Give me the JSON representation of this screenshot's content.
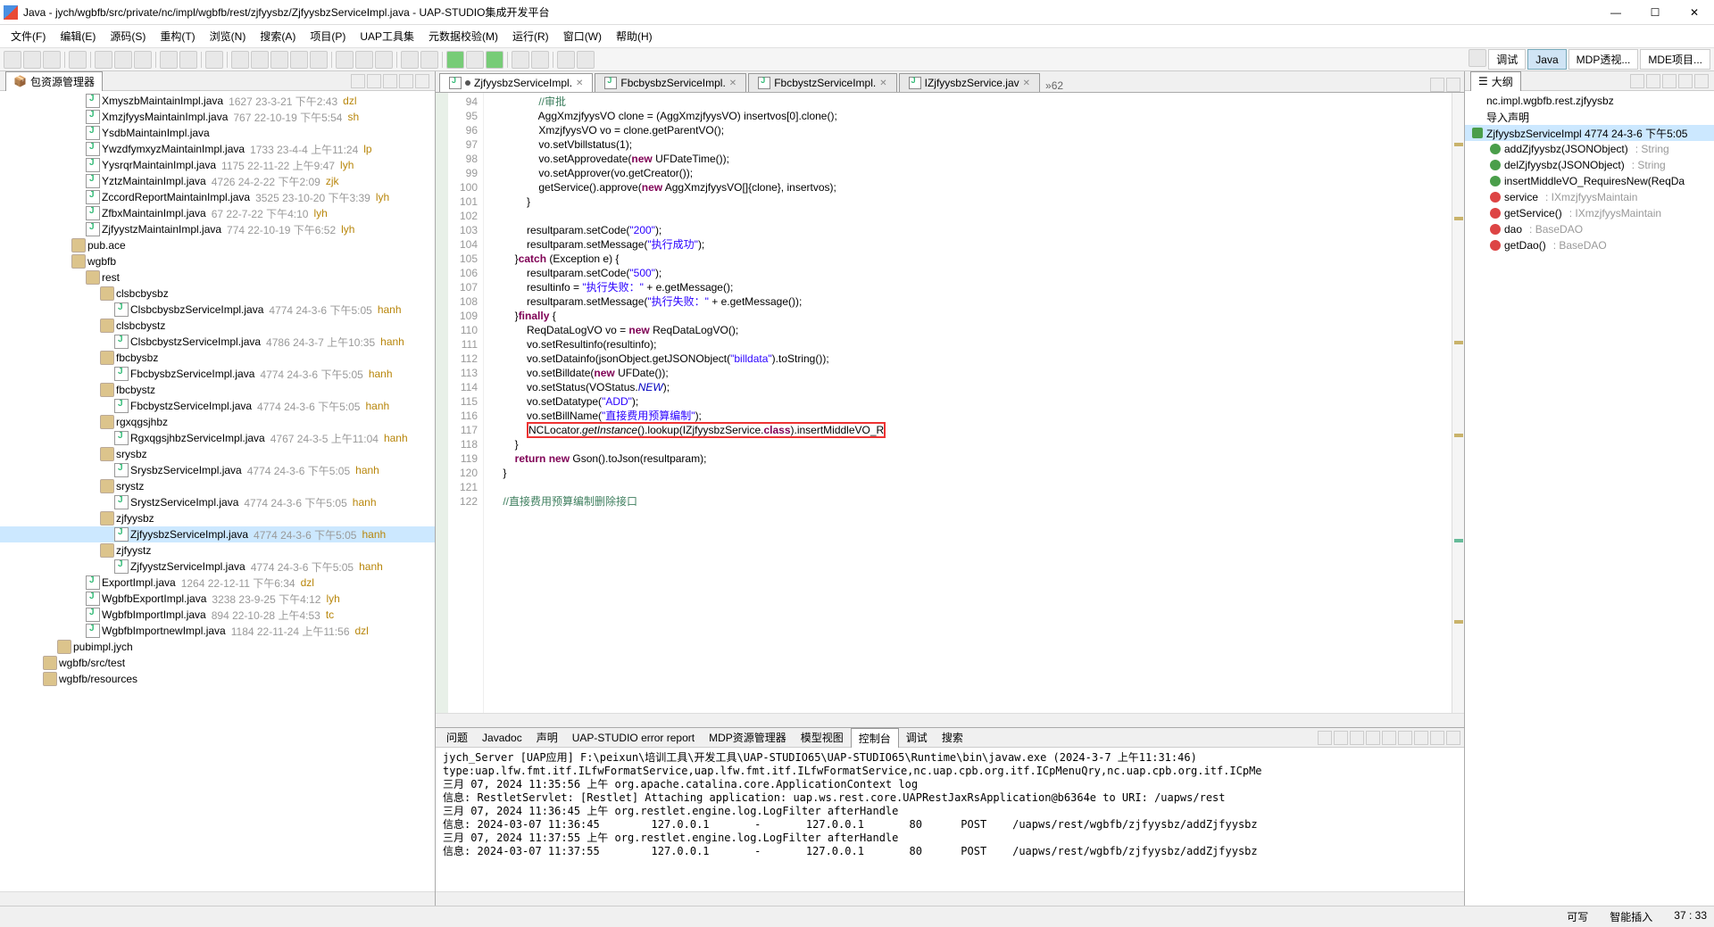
{
  "window": {
    "title": "Java - jych/wgbfb/src/private/nc/impl/wgbfb/rest/zjfyysbz/ZjfyysbzServiceImpl.java - UAP-STUDIO集成开发平台"
  },
  "menu": [
    "文件(F)",
    "编辑(E)",
    "源码(S)",
    "重构(T)",
    "浏览(N)",
    "搜索(A)",
    "项目(P)",
    "UAP工具集",
    "元数据校验(M)",
    "运行(R)",
    "窗口(W)",
    "帮助(H)"
  ],
  "perspectives": [
    {
      "label": "调试",
      "sel": false
    },
    {
      "label": "Java",
      "sel": true
    },
    {
      "label": "MDP透视...",
      "sel": false
    },
    {
      "label": "MDE项目...",
      "sel": false
    }
  ],
  "pkgExplorer": {
    "title": "包资源管理器"
  },
  "tree": [
    {
      "ind": 96,
      "icon": "java",
      "name": "XmyszbMaintainImpl.java",
      "meta": "1627  23-3-21 下午2:43",
      "auth": "dzl"
    },
    {
      "ind": 96,
      "icon": "java",
      "name": "XmzjfyysMaintainImpl.java",
      "meta": "767  22-10-19 下午5:54",
      "auth": "sh"
    },
    {
      "ind": 96,
      "icon": "java",
      "name": "YsdbMaintainImpl.java",
      "meta": "",
      "auth": ""
    },
    {
      "ind": 96,
      "icon": "java",
      "name": "YwzdfymxyzMaintainImpl.java",
      "meta": "1733  23-4-4 上午11:24",
      "auth": "lp"
    },
    {
      "ind": 96,
      "icon": "java",
      "name": "YysrqrMaintainImpl.java",
      "meta": "1175  22-11-22 上午9:47",
      "auth": "lyh"
    },
    {
      "ind": 96,
      "icon": "java",
      "name": "YztzMaintainImpl.java",
      "meta": "4726  24-2-22 下午2:09",
      "auth": "zjk"
    },
    {
      "ind": 96,
      "icon": "java",
      "name": "ZccordReportMaintainImpl.java",
      "meta": "3525  23-10-20 下午3:39",
      "auth": "lyh"
    },
    {
      "ind": 96,
      "icon": "java",
      "name": "ZfbxMaintainImpl.java",
      "meta": "67  22-7-22 下午4:10",
      "auth": "lyh"
    },
    {
      "ind": 96,
      "icon": "java",
      "name": "ZjfyystzMaintainImpl.java",
      "meta": "774  22-10-19 下午6:52",
      "auth": "lyh"
    },
    {
      "ind": 80,
      "icon": "pkg",
      "name": "pub.ace",
      "meta": "",
      "auth": ""
    },
    {
      "ind": 80,
      "icon": "pkg",
      "name": "wgbfb",
      "meta": "",
      "auth": ""
    },
    {
      "ind": 96,
      "icon": "pkg",
      "name": "rest",
      "meta": "",
      "auth": ""
    },
    {
      "ind": 112,
      "icon": "pkg",
      "name": "clsbcbysbz",
      "meta": "",
      "auth": ""
    },
    {
      "ind": 128,
      "icon": "java",
      "name": "ClsbcbysbzServiceImpl.java",
      "meta": "4774  24-3-6 下午5:05",
      "auth": "hanh"
    },
    {
      "ind": 112,
      "icon": "pkg",
      "name": "clsbcbystz",
      "meta": "",
      "auth": ""
    },
    {
      "ind": 128,
      "icon": "java",
      "name": "ClsbcbystzServiceImpl.java",
      "meta": "4786  24-3-7 上午10:35",
      "auth": "hanh"
    },
    {
      "ind": 112,
      "icon": "pkg",
      "name": "fbcbysbz",
      "meta": "",
      "auth": ""
    },
    {
      "ind": 128,
      "icon": "java",
      "name": "FbcbysbzServiceImpl.java",
      "meta": "4774  24-3-6 下午5:05",
      "auth": "hanh"
    },
    {
      "ind": 112,
      "icon": "pkg",
      "name": "fbcbystz",
      "meta": "",
      "auth": ""
    },
    {
      "ind": 128,
      "icon": "java",
      "name": "FbcbystzServiceImpl.java",
      "meta": "4774  24-3-6 下午5:05",
      "auth": "hanh"
    },
    {
      "ind": 112,
      "icon": "pkg",
      "name": "rgxqgsjhbz",
      "meta": "",
      "auth": ""
    },
    {
      "ind": 128,
      "icon": "java",
      "name": "RgxqgsjhbzServiceImpl.java",
      "meta": "4767  24-3-5 上午11:04",
      "auth": "hanh"
    },
    {
      "ind": 112,
      "icon": "pkg",
      "name": "srysbz",
      "meta": "",
      "auth": ""
    },
    {
      "ind": 128,
      "icon": "java",
      "name": "SrysbzServiceImpl.java",
      "meta": "4774  24-3-6 下午5:05",
      "auth": "hanh"
    },
    {
      "ind": 112,
      "icon": "pkg",
      "name": "srystz",
      "meta": "",
      "auth": ""
    },
    {
      "ind": 128,
      "icon": "java",
      "name": "SrystzServiceImpl.java",
      "meta": "4774  24-3-6 下午5:05",
      "auth": "hanh"
    },
    {
      "ind": 112,
      "icon": "pkg",
      "name": "zjfyysbz",
      "meta": "",
      "auth": ""
    },
    {
      "ind": 128,
      "icon": "java",
      "name": "ZjfyysbzServiceImpl.java",
      "meta": "4774  24-3-6 下午5:05",
      "auth": "hanh",
      "sel": true
    },
    {
      "ind": 112,
      "icon": "pkg",
      "name": "zjfyystz",
      "meta": "",
      "auth": ""
    },
    {
      "ind": 128,
      "icon": "java",
      "name": "ZjfyystzServiceImpl.java",
      "meta": "4774  24-3-6 下午5:05",
      "auth": "hanh"
    },
    {
      "ind": 96,
      "icon": "java",
      "name": "ExportImpl.java",
      "meta": "1264  22-12-11 下午6:34",
      "auth": "dzl"
    },
    {
      "ind": 96,
      "icon": "java",
      "name": "WgbfbExportImpl.java",
      "meta": "3238  23-9-25 下午4:12",
      "auth": "lyh"
    },
    {
      "ind": 96,
      "icon": "java",
      "name": "WgbfbImportImpl.java",
      "meta": "894  22-10-28 上午4:53",
      "auth": "tc"
    },
    {
      "ind": 96,
      "icon": "java",
      "name": "WgbfbImportnewImpl.java",
      "meta": "1184  22-11-24 上午11:56",
      "auth": "dzl"
    },
    {
      "ind": 64,
      "icon": "pkg",
      "name": "pubimpl.jych",
      "meta": "",
      "auth": ""
    },
    {
      "ind": 48,
      "icon": "pkg",
      "name": "wgbfb/src/test",
      "meta": "",
      "auth": ""
    },
    {
      "ind": 48,
      "icon": "pkg",
      "name": "wgbfb/resources",
      "meta": "",
      "auth": ""
    }
  ],
  "editorTabs": [
    {
      "label": "ZjfyysbzServiceImpl.",
      "act": true,
      "dirty": true
    },
    {
      "label": "FbcbysbzServiceImpl.",
      "act": false
    },
    {
      "label": "FbcbystzServiceImpl.",
      "act": false
    },
    {
      "label": "IZjfyysbzService.jav",
      "act": false
    }
  ],
  "tabOverflow": "»62",
  "lineStart": 94,
  "lineEnd": 122,
  "code": [
    {
      "n": 94,
      "t": "                //审批",
      "cls": "cmt"
    },
    {
      "n": 95,
      "t": "                AggXmzjfyysVO clone = (AggXmzjfyysVO) insertvos[0].clone();"
    },
    {
      "n": 96,
      "t": "                XmzjfyysVO vo = clone.getParentVO();"
    },
    {
      "n": 97,
      "t": "                vo.setVbillstatus(1);"
    },
    {
      "n": 98,
      "raw": "                vo.setApprovedate(<span class='kw'>new</span> UFDateTime());"
    },
    {
      "n": 99,
      "t": "                vo.setApprover(vo.getCreator());"
    },
    {
      "n": 100,
      "raw": "                getService().approve(<span class='kw'>new</span> AggXmzjfyysVO[]{clone}, insertvos);"
    },
    {
      "n": 101,
      "t": "            }"
    },
    {
      "n": 102,
      "t": ""
    },
    {
      "n": 103,
      "raw": "            resultparam.setCode(<span class='str'>\"200\"</span>);"
    },
    {
      "n": 104,
      "raw": "            resultparam.setMessage(<span class='str'>\"执行成功\"</span>);"
    },
    {
      "n": 105,
      "raw": "        }<span class='kw'>catch</span> (Exception e) {"
    },
    {
      "n": 106,
      "raw": "            resultparam.setCode(<span class='str'>\"500\"</span>);"
    },
    {
      "n": 107,
      "raw": "            resultinfo = <span class='str'>\"执行失败：\"</span> + e.getMessage();"
    },
    {
      "n": 108,
      "raw": "            resultparam.setMessage(<span class='str'>\"执行失败：\"</span> + e.getMessage());"
    },
    {
      "n": 109,
      "raw": "        }<span class='kw'>finally</span> {"
    },
    {
      "n": 110,
      "raw": "            ReqDataLogVO vo = <span class='kw'>new</span> ReqDataLogVO();"
    },
    {
      "n": 111,
      "t": "            vo.setResultinfo(resultinfo);"
    },
    {
      "n": 112,
      "raw": "            vo.setDatainfo(jsonObject.getJSONObject(<span class='str'>\"billdata\"</span>).toString());"
    },
    {
      "n": 113,
      "raw": "            vo.setBilldate(<span class='kw'>new</span> UFDate());"
    },
    {
      "n": 114,
      "raw": "            vo.setStatus(VOStatus.<span class='fld it'>NEW</span>);"
    },
    {
      "n": 115,
      "raw": "            vo.setDatatype(<span class='str'>\"ADD\"</span>);"
    },
    {
      "n": 116,
      "raw": "            vo.setBillName(<span class='str'>\"直接费用预算编制\"</span>);"
    },
    {
      "n": 117,
      "raw": "            <span class='hl'>NCLocator.<span class='it'>getInstance</span>().lookup(IZjfyysbzService.<span class='kw'>class</span>).insertMiddleVO_R</span>"
    },
    {
      "n": 118,
      "t": "        }"
    },
    {
      "n": 119,
      "raw": "        <span class='kw'>return</span> <span class='kw'>new</span> Gson().toJson(resultparam);"
    },
    {
      "n": 120,
      "t": "    }"
    },
    {
      "n": 121,
      "t": ""
    },
    {
      "n": 122,
      "t": "    //直接费用预算编制删除接口",
      "cls": "cmt"
    }
  ],
  "outline": {
    "title": "大纲",
    "items": [
      {
        "icon": "pkg",
        "label": "nc.impl.wgbfb.rest.zjfyysbz"
      },
      {
        "icon": "imp",
        "label": "导入声明"
      },
      {
        "icon": "cls",
        "label": "ZjfyysbzServiceImpl 4774  24-3-6 下午5:05",
        "sel": true
      },
      {
        "icon": "pub",
        "label": "addZjfyysbz(JSONObject)",
        "ret": ": String"
      },
      {
        "icon": "pub",
        "label": "delZjfyysbz(JSONObject)",
        "ret": ": String"
      },
      {
        "icon": "pub",
        "label": "insertMiddleVO_RequiresNew(ReqDa"
      },
      {
        "icon": "pri",
        "label": "service",
        "ret": ": IXmzjfyysMaintain"
      },
      {
        "icon": "pri",
        "label": "getService()",
        "ret": ": IXmzjfyysMaintain"
      },
      {
        "icon": "pri",
        "label": "dao",
        "ret": ": BaseDAO"
      },
      {
        "icon": "pri",
        "label": "getDao()",
        "ret": ": BaseDAO"
      }
    ]
  },
  "bottomTabs": [
    "问题",
    "Javadoc",
    "声明",
    "UAP-STUDIO error report",
    "MDP资源管理器",
    "模型视图",
    "控制台",
    "调试",
    "搜索"
  ],
  "bottomActive": 6,
  "console": "jych_Server [UAP应用] F:\\peixun\\培训工具\\开发工具\\UAP-STUDIO65\\UAP-STUDIO65\\Runtime\\bin\\javaw.exe (2024-3-7 上午11:31:46)\ntype:uap.lfw.fmt.itf.ILfwFormatService,uap.lfw.fmt.itf.ILfwFormatService,nc.uap.cpb.org.itf.ICpMenuQry,nc.uap.cpb.org.itf.ICpMe\n三月 07, 2024 11:35:56 上午 org.apache.catalina.core.ApplicationContext log\n信息: RestletServlet: [Restlet] Attaching application: uap.ws.rest.core.UAPRestJaxRsApplication@b6364e to URI: /uapws/rest\n三月 07, 2024 11:36:45 上午 org.restlet.engine.log.LogFilter afterHandle\n信息: 2024-03-07 11:36:45        127.0.0.1       -       127.0.0.1       80      POST    /uapws/rest/wgbfb/zjfyysbz/addZjfyysbz\n三月 07, 2024 11:37:55 上午 org.restlet.engine.log.LogFilter afterHandle\n信息: 2024-03-07 11:37:55        127.0.0.1       -       127.0.0.1       80      POST    /uapws/rest/wgbfb/zjfyysbz/addZjfyysbz",
  "status": {
    "write": "可写",
    "insert": "智能插入",
    "pos": "37 : 33"
  }
}
